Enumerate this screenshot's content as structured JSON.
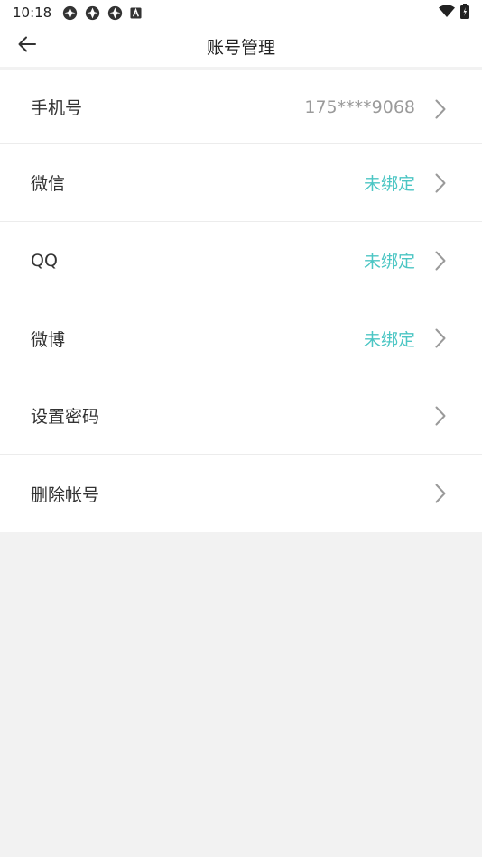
{
  "status_bar": {
    "time": "10:18",
    "icons": [
      "aperture-icon",
      "aperture-icon",
      "aperture-icon",
      "a-box-icon"
    ],
    "right_icons": [
      "wifi-icon",
      "battery-icon"
    ]
  },
  "header": {
    "title": "账号管理",
    "back_icon": "arrow-left-icon"
  },
  "account_bindings": [
    {
      "label": "手机号",
      "value": "175****9068",
      "status": "bound"
    },
    {
      "label": "微信",
      "value": "未绑定",
      "status": "unbound"
    },
    {
      "label": "QQ",
      "value": "未绑定",
      "status": "unbound"
    },
    {
      "label": "微博",
      "value": "未绑定",
      "status": "unbound"
    }
  ],
  "security": [
    {
      "label": "设置密码"
    },
    {
      "label": "删除帐号"
    }
  ],
  "colors": {
    "unbound": "#4cc6c4",
    "value_gray": "#9a9a9a",
    "background": "#f2f2f2"
  }
}
